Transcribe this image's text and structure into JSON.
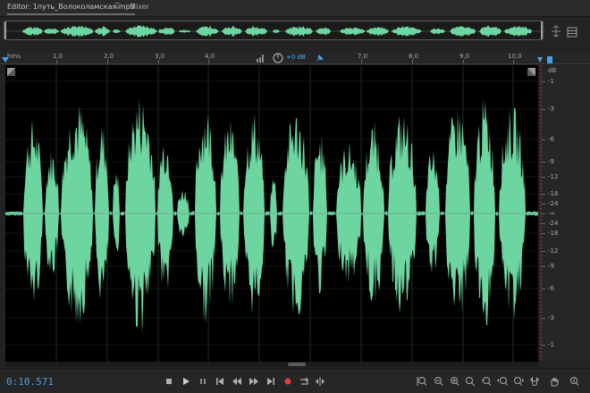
{
  "tabs": {
    "editor_label": "Editor: 1путь_Волоколамская.mp3",
    "editor_menu_icon": "hamburger-icon",
    "mixer_label": "Mixer"
  },
  "ruler": {
    "unit": "hms",
    "ticks": [
      "1,0",
      "2,0",
      "3,0",
      "4,0",
      "7,0",
      "8,0",
      "9,0",
      "10,0"
    ],
    "volume_value": "+0 dB"
  },
  "db_scale": {
    "unit": "dB",
    "labels": [
      "-1",
      "-3",
      "-6",
      "-9",
      "-12",
      "-18",
      "-24",
      "-∞",
      "-24",
      "-18",
      "-12",
      "-9",
      "-6",
      "-3",
      "-1"
    ]
  },
  "transport": {
    "timecode": "0:10.571",
    "buttons": [
      "stop",
      "play",
      "pause",
      "go-to-start",
      "rewind",
      "fast-forward",
      "go-to-end",
      "record",
      "loop",
      "skip-selection"
    ],
    "zoom_buttons": [
      "zoom-in-amplitude",
      "zoom-out-amplitude",
      "zoom-out-full",
      "zoom-in",
      "zoom-out",
      "zoom-in-left",
      "zoom-in-right",
      "zoom-selection",
      "zoom-full-view",
      "hand"
    ]
  },
  "colors": {
    "waveform": "#6dd6a0",
    "background": "#000000",
    "accent": "#4a9de8",
    "record": "#e83a3a"
  }
}
